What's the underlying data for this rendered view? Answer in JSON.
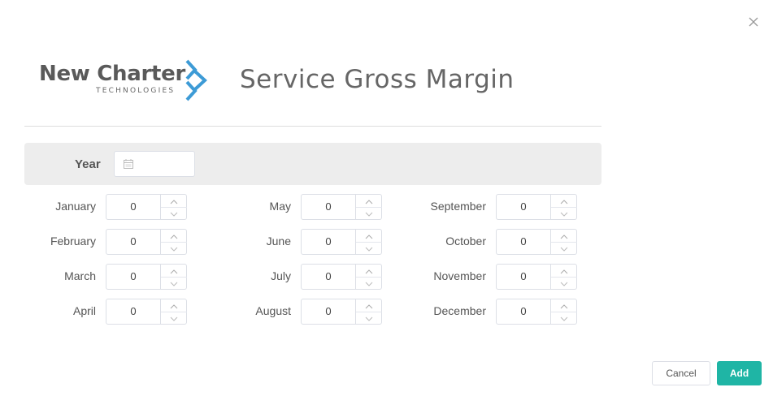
{
  "header": {
    "logo_brand": "New Charter",
    "logo_tagline": "TECHNOLOGIES",
    "title": "Service Gross Margin"
  },
  "year": {
    "label": "Year",
    "value": ""
  },
  "months": [
    {
      "label": "January",
      "value": "0"
    },
    {
      "label": "February",
      "value": "0"
    },
    {
      "label": "March",
      "value": "0"
    },
    {
      "label": "April",
      "value": "0"
    },
    {
      "label": "May",
      "value": "0"
    },
    {
      "label": "June",
      "value": "0"
    },
    {
      "label": "July",
      "value": "0"
    },
    {
      "label": "August",
      "value": "0"
    },
    {
      "label": "September",
      "value": "0"
    },
    {
      "label": "October",
      "value": "0"
    },
    {
      "label": "November",
      "value": "0"
    },
    {
      "label": "December",
      "value": "0"
    }
  ],
  "footer": {
    "cancel_label": "Cancel",
    "add_label": "Add"
  },
  "colors": {
    "accent": "#1fb5a5",
    "logo_chevron": "#3d9bd6"
  },
  "icons": [
    "close-icon",
    "calendar-icon",
    "chevron-up-icon",
    "chevron-down-icon"
  ]
}
